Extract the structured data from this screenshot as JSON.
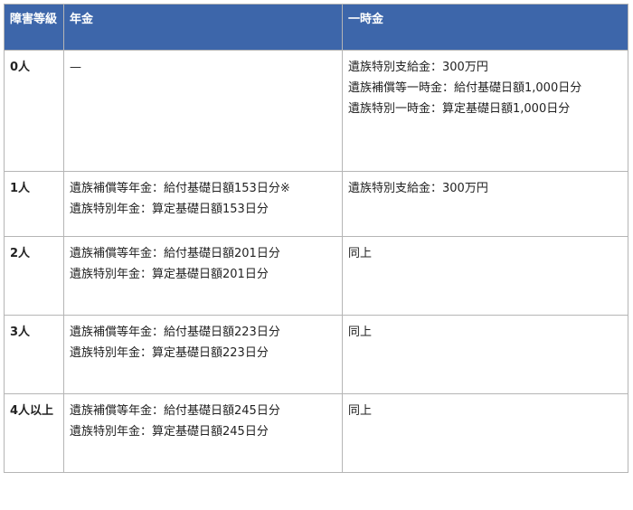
{
  "table": {
    "headers": [
      "障害等級",
      "年金",
      "一時金"
    ],
    "rows": [
      {
        "grade": "0人",
        "pension": [
          "—"
        ],
        "lump_sum": [
          "遺族特別支給金：300万円",
          "遺族補償等一時金：給付基礎日額1,000日分",
          "遺族特別一時金：算定基礎日額1,000日分"
        ]
      },
      {
        "grade": "1人",
        "pension": [
          "遺族補償等年金：給付基礎日額153日分※",
          "遺族特別年金：算定基礎日額153日分"
        ],
        "lump_sum": [
          "遺族特別支給金：300万円"
        ]
      },
      {
        "grade": "2人",
        "pension": [
          "遺族補償等年金：給付基礎日額201日分",
          "遺族特別年金：算定基礎日額201日分"
        ],
        "lump_sum": [
          "同上"
        ]
      },
      {
        "grade": "3人",
        "pension": [
          "遺族補償等年金：給付基礎日額223日分",
          "遺族特別年金：算定基礎日額223日分"
        ],
        "lump_sum": [
          "同上"
        ]
      },
      {
        "grade": "4人以上",
        "pension": [
          "遺族補償等年金：給付基礎日額245日分",
          "遺族特別年金：算定基礎日額245日分"
        ],
        "lump_sum": [
          "同上"
        ]
      }
    ]
  },
  "colors": {
    "header_bg": "#3d66aa",
    "header_text": "#ffffff",
    "border": "#b5b5b5",
    "body_text": "#222222"
  }
}
